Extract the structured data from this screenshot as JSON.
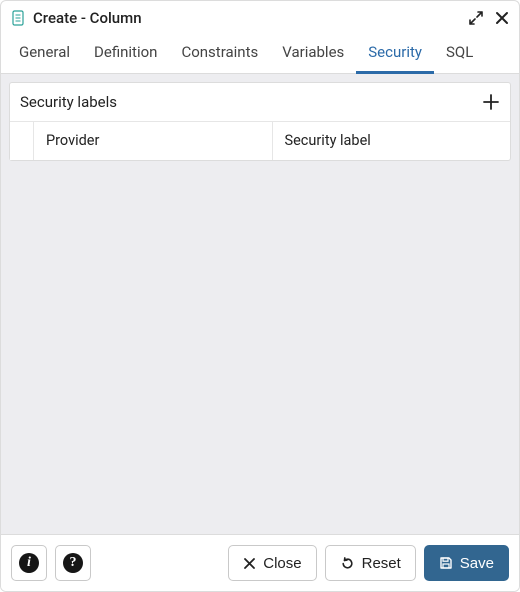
{
  "dialog": {
    "title": "Create - Column"
  },
  "tabs": [
    {
      "label": "General",
      "active": false
    },
    {
      "label": "Definition",
      "active": false
    },
    {
      "label": "Constraints",
      "active": false
    },
    {
      "label": "Variables",
      "active": false
    },
    {
      "label": "Security",
      "active": true
    },
    {
      "label": "SQL",
      "active": false
    }
  ],
  "security_panel": {
    "title": "Security labels",
    "columns": [
      "Provider",
      "Security label"
    ],
    "rows": []
  },
  "footer": {
    "close_label": "Close",
    "reset_label": "Reset",
    "save_label": "Save"
  },
  "icons": {
    "info_char": "i",
    "help_char": "?"
  }
}
